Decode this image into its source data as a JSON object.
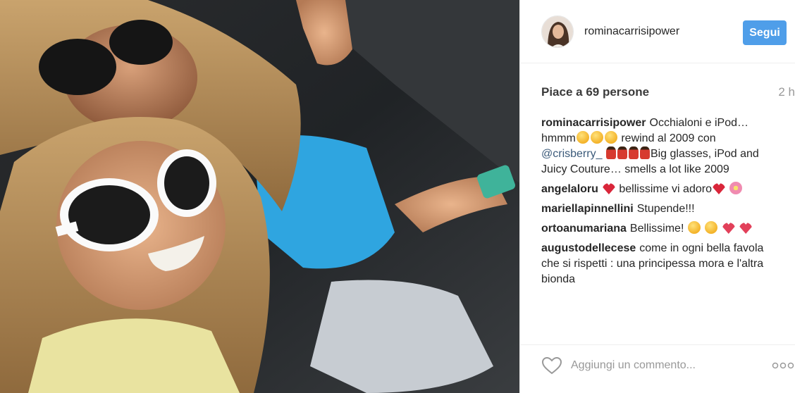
{
  "post": {
    "username": "rominacarrisipower",
    "follow_label": "Segui",
    "likes_text": "Piace a 69 persone",
    "time_text": "2 h"
  },
  "caption": {
    "user": "rominacarrisipower",
    "part1": "Occhialoni e iPod… hmmm",
    "part2": " rewind al 2009 con ",
    "mention": "@crisberry_",
    "part3": "Big glasses, iPod and Juicy Couture… smells a lot like 2009"
  },
  "comments": [
    {
      "user": "angelaloru",
      "text": "bellissime vi adoro"
    },
    {
      "user": "mariellapinnellini",
      "text": "Stupende!!!"
    },
    {
      "user": "ortoanumariana",
      "text": "Bellissime!"
    },
    {
      "user": "augustodellecese",
      "text": "come in ogni bella favola che si rispetti : una principessa mora e l'altra bionda"
    }
  ],
  "footer": {
    "comment_placeholder": "Aggiungi un commento...",
    "like_icon": "heart-outline-icon",
    "more_icon": "more-options-icon"
  },
  "colors": {
    "follow_button": "#4f9ee9",
    "link": "#3b5a7a",
    "muted": "#999999"
  }
}
